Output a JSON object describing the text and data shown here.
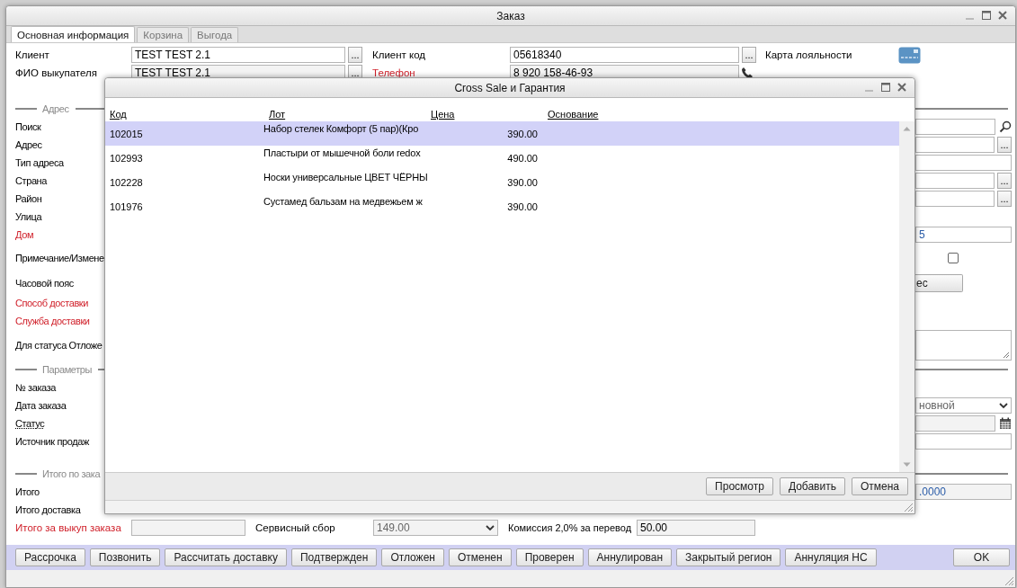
{
  "window": {
    "title": "Заказ"
  },
  "tabs": [
    {
      "label": "Основная информация",
      "selected": true
    },
    {
      "label": "Корзина",
      "selected": false
    },
    {
      "label": "Выгода",
      "selected": false
    }
  ],
  "header": {
    "client": {
      "label": "Клиент",
      "required": false,
      "value": "TEST TEST 2.1",
      "readonly": false,
      "button": "..."
    },
    "buyer": {
      "label": "ФИО выкупателя",
      "required": false,
      "value": "TEST TEST 2.1",
      "readonly": true,
      "button": "..."
    },
    "client_code": {
      "label": "Клиент код",
      "required": false,
      "value": "05618340",
      "readonly": false,
      "button": "..."
    },
    "phone": {
      "label": "Телефон",
      "required": true,
      "value": "8 920 158-46-93",
      "readonly": true
    },
    "loyalty": {
      "label": "Карта лояльности"
    }
  },
  "sections": [
    {
      "title": "Адрес",
      "rows": [
        {
          "label": "Поиск",
          "required": false,
          "control": {
            "kind": "search"
          }
        },
        {
          "label": "Адрес",
          "required": false,
          "control": {
            "kind": "picker",
            "button": "..."
          }
        },
        {
          "label": "Тип адреса",
          "required": false,
          "control": {
            "kind": "text"
          }
        },
        {
          "label": "Страна",
          "required": false,
          "control": {
            "kind": "picker",
            "button": "..."
          }
        },
        {
          "label": "Район",
          "required": false,
          "control": {
            "kind": "picker",
            "button": "..."
          }
        },
        {
          "label": "Улица",
          "required": false
        },
        {
          "label": "Дом",
          "required": true,
          "control": {
            "kind": "text",
            "value": "5"
          }
        },
        {
          "label": "Примечание/Измене",
          "required": false,
          "control": {
            "kind": "checkbox",
            "checked": false
          }
        },
        {
          "label": "Часовой пояс",
          "required": false,
          "control": {
            "kind": "button",
            "label": "ес"
          }
        },
        {
          "label": "Способ доставки",
          "required": true
        },
        {
          "label": "Служба доставки",
          "required": true
        },
        {
          "label": "Для статуса Отложе",
          "required": false,
          "control": {
            "kind": "textarea"
          }
        }
      ]
    },
    {
      "title": "Параметры",
      "rows": [
        {
          "label": "№ заказа",
          "required": false,
          "hint": false
        },
        {
          "label": "Дата заказа",
          "required": false,
          "hint": false,
          "control": {
            "kind": "select",
            "value": "новной"
          }
        },
        {
          "label": "Статус",
          "required": false,
          "hint": true,
          "control": {
            "kind": "date"
          }
        },
        {
          "label": "Источник продаж",
          "required": false,
          "hint": false,
          "control": {
            "kind": "text"
          }
        }
      ]
    },
    {
      "title": "Итого по зака",
      "rows": [
        {
          "label": "Итого",
          "required": false,
          "control": {
            "kind": "text",
            "value": ".0000",
            "readonly": true
          }
        },
        {
          "label": "Итого доставка",
          "required": false
        }
      ]
    }
  ],
  "buyout": {
    "label": "Итого за выкуп заказа",
    "required": true,
    "service_fee": {
      "label": "Сервисный сбор",
      "value": "149.00"
    },
    "commission": {
      "label": "Комиссия 2,0% за перевод",
      "value": "50.00"
    }
  },
  "actions": [
    "Рассрочка",
    "Позвонить",
    "Рассчитать доставку",
    "Подтвержден",
    "Отложен",
    "Отменен",
    "Проверен",
    "Аннулирован",
    "Закрытый регион",
    "Аннуляция НС"
  ],
  "ok": "OK",
  "dialog": {
    "title": "Cross Sale и Гарантия",
    "columns": [
      "Код",
      "Лот",
      "Цена",
      "Основание"
    ],
    "rows": [
      {
        "code": "102015",
        "lot": "Набор стелек Комфорт (5 пар)(Кро",
        "price": "390.00",
        "selected": true
      },
      {
        "code": "102993",
        "lot": "Пластыри от мышечной боли redox",
        "price": "490.00",
        "selected": false
      },
      {
        "code": "102228",
        "lot": "Носки универсальные ЦВЕТ ЧЁРНЫ",
        "price": "390.00",
        "selected": false
      },
      {
        "code": "101976",
        "lot": "Сустамед бальзам на медвежьем ж",
        "price": "390.00",
        "selected": false
      }
    ],
    "buttons": [
      "Просмотр",
      "Добавить",
      "Отмена"
    ]
  }
}
